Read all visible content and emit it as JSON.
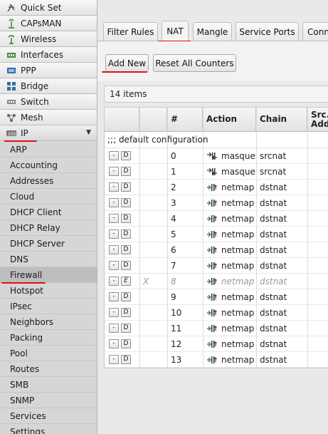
{
  "sidebar": {
    "items": [
      {
        "label": "Quick Set",
        "icon": "quick-set-icon"
      },
      {
        "label": "CAPsMAN",
        "icon": "capsman-icon"
      },
      {
        "label": "Wireless",
        "icon": "wireless-icon"
      },
      {
        "label": "Interfaces",
        "icon": "interfaces-icon"
      },
      {
        "label": "PPP",
        "icon": "ppp-icon"
      },
      {
        "label": "Bridge",
        "icon": "bridge-icon"
      },
      {
        "label": "Switch",
        "icon": "switch-icon"
      },
      {
        "label": "Mesh",
        "icon": "mesh-icon"
      },
      {
        "label": "IP",
        "icon": "ip-icon",
        "expanded": true,
        "chevron": "▼"
      }
    ],
    "ip_submenu": [
      "ARP",
      "Accounting",
      "Addresses",
      "Cloud",
      "DHCP Client",
      "DHCP Relay",
      "DHCP Server",
      "DNS",
      "Firewall",
      "Hotspot",
      "IPsec",
      "Neighbors",
      "Packing",
      "Pool",
      "Routes",
      "SMB",
      "SNMP",
      "Services",
      "Settings"
    ],
    "selected_submenu": "Firewall"
  },
  "tabs": [
    "Filter Rules",
    "NAT",
    "Mangle",
    "Service Ports",
    "Conn"
  ],
  "active_tab": "NAT",
  "toolbar": {
    "add_new": "Add New",
    "reset_counters": "Reset All Counters"
  },
  "items_count": "14 items",
  "table": {
    "headers": [
      "",
      "",
      "#",
      "Action",
      "Chain",
      "Src. Add"
    ],
    "group_label": ";;; default configuration",
    "rows": [
      {
        "btn1": "-",
        "btn2": "D",
        "flag": "",
        "num": "0",
        "action": "masquerade",
        "action_icon": "masquerade-icon",
        "chain": "srcnat"
      },
      {
        "btn1": "-",
        "btn2": "D",
        "flag": "",
        "num": "1",
        "action": "masquerade",
        "action_icon": "masquerade-icon",
        "chain": "srcnat"
      },
      {
        "btn1": "-",
        "btn2": "D",
        "flag": "",
        "num": "2",
        "action": "netmap",
        "action_icon": "netmap-icon",
        "chain": "dstnat"
      },
      {
        "btn1": "-",
        "btn2": "D",
        "flag": "",
        "num": "3",
        "action": "netmap",
        "action_icon": "netmap-icon",
        "chain": "dstnat"
      },
      {
        "btn1": "-",
        "btn2": "D",
        "flag": "",
        "num": "4",
        "action": "netmap",
        "action_icon": "netmap-icon",
        "chain": "dstnat"
      },
      {
        "btn1": "-",
        "btn2": "D",
        "flag": "",
        "num": "5",
        "action": "netmap",
        "action_icon": "netmap-icon",
        "chain": "dstnat"
      },
      {
        "btn1": "-",
        "btn2": "D",
        "flag": "",
        "num": "6",
        "action": "netmap",
        "action_icon": "netmap-icon",
        "chain": "dstnat"
      },
      {
        "btn1": "-",
        "btn2": "D",
        "flag": "",
        "num": "7",
        "action": "netmap",
        "action_icon": "netmap-icon",
        "chain": "dstnat"
      },
      {
        "btn1": "-",
        "btn2": "E",
        "flag": "X",
        "num": "8",
        "action": "netmap",
        "action_icon": "netmap-icon",
        "chain": "dstnat",
        "disabled": true
      },
      {
        "btn1": "-",
        "btn2": "D",
        "flag": "",
        "num": "9",
        "action": "netmap",
        "action_icon": "netmap-icon",
        "chain": "dstnat"
      },
      {
        "btn1": "-",
        "btn2": "D",
        "flag": "",
        "num": "10",
        "action": "netmap",
        "action_icon": "netmap-icon",
        "chain": "dstnat"
      },
      {
        "btn1": "-",
        "btn2": "D",
        "flag": "",
        "num": "11",
        "action": "netmap",
        "action_icon": "netmap-icon",
        "chain": "dstnat"
      },
      {
        "btn1": "-",
        "btn2": "D",
        "flag": "",
        "num": "12",
        "action": "netmap",
        "action_icon": "netmap-icon",
        "chain": "dstnat"
      },
      {
        "btn1": "-",
        "btn2": "D",
        "flag": "",
        "num": "13",
        "action": "netmap",
        "action_icon": "netmap-icon",
        "chain": "dstnat"
      }
    ]
  },
  "colors": {
    "annotation_red": "#d11111",
    "selected_item": "#bebebe"
  }
}
